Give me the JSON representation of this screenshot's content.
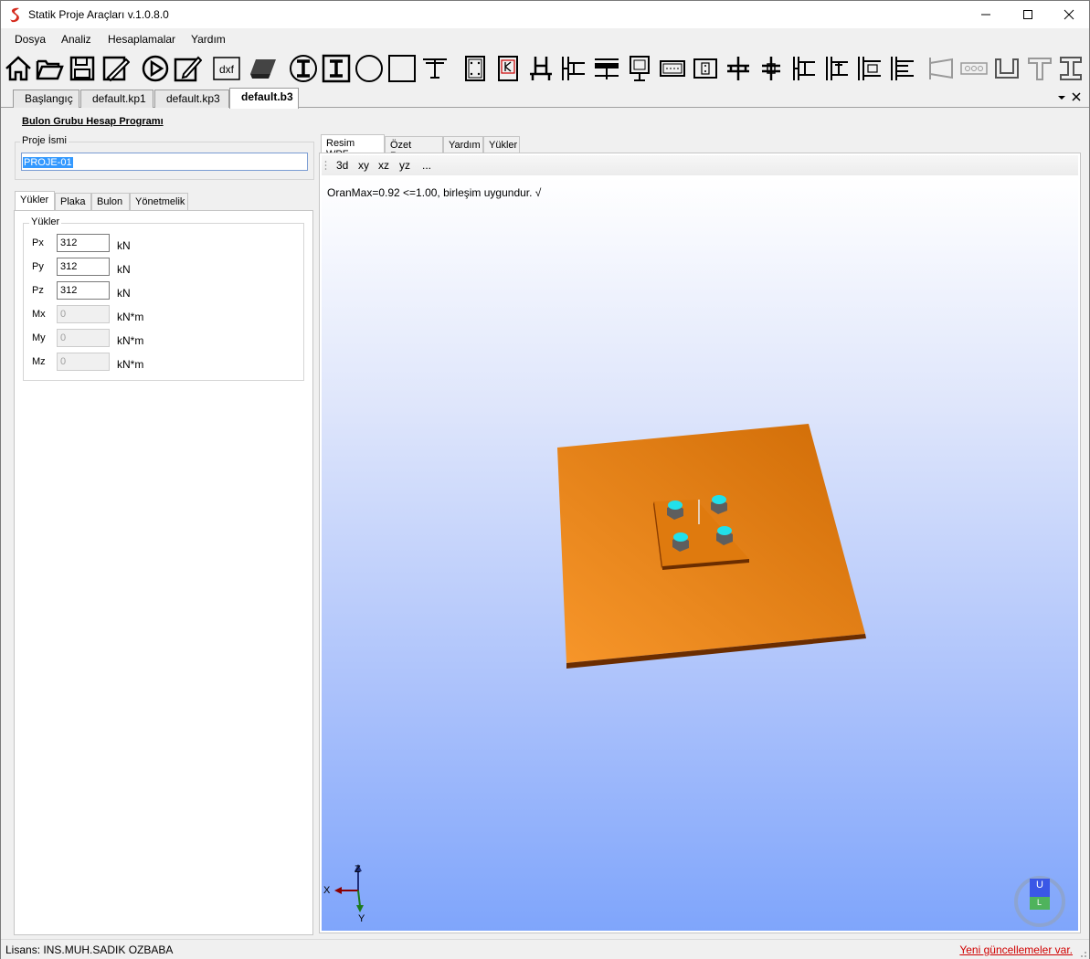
{
  "window": {
    "title": "Statik Proje Araçları v.1.0.8.0",
    "controls": {
      "minimize": "—",
      "maximize": "☐",
      "close": "✕"
    }
  },
  "menu": [
    "Dosya",
    "Analiz",
    "Hesaplamalar",
    "Yardım"
  ],
  "toolbar": {
    "icons": [
      "home-icon",
      "open-folder-icon",
      "save-icon",
      "edit-drawing-icon",
      "run-icon",
      "pencil-icon",
      "dxf-icon",
      "plate-3d-icon",
      "i-beam-circle-icon",
      "i-beam-square-icon",
      "circle-section-icon",
      "square-section-icon",
      "t-section-icon",
      "bolt-plate-icon",
      "k-plate-icon",
      "column-base-icon",
      "beam-column-icon",
      "beam-splice-icon",
      "end-plate-icon",
      "plate-bolts-icon",
      "flange-splice-icon",
      "column-splice-icon",
      "web-splice-icon",
      "shear-tab-icon",
      "double-angle-icon",
      "seat-angle-icon",
      "stiffener-icon",
      "gusset-icon",
      "bracing-icon",
      "angle-section-icon",
      "bolt-row-icon",
      "channel-section-icon",
      "tee-section-icon",
      "i-section-icon"
    ],
    "dxf_label": "dxf"
  },
  "doc_tabs": [
    "Başlangıç",
    "default.kp1",
    "default.kp3",
    "default.b3"
  ],
  "active_doc_tab": "default.b3",
  "left": {
    "program_title": "Bulon Grubu Hesap Programı",
    "project_group_label": "Proje İsmi",
    "project_name": "PROJE-01",
    "tabs": [
      "Yükler",
      "Plaka",
      "Bulon",
      "Yönetmelik"
    ],
    "loads_group_label": "Yükler",
    "loads": [
      {
        "label": "Px",
        "value": "312",
        "unit": "kN",
        "enabled": true
      },
      {
        "label": "Py",
        "value": "312",
        "unit": "kN",
        "enabled": true
      },
      {
        "label": "Pz",
        "value": "312",
        "unit": "kN",
        "enabled": true
      },
      {
        "label": "Mx",
        "value": "0",
        "unit": "kN*m",
        "enabled": false
      },
      {
        "label": "My",
        "value": "0",
        "unit": "kN*m",
        "enabled": false
      },
      {
        "label": "Mz",
        "value": "0",
        "unit": "kN*m",
        "enabled": false
      }
    ]
  },
  "right": {
    "tabs": [
      "Resim WPF",
      "Özet Rapor",
      "Yardım",
      "Yükler"
    ],
    "view_buttons": [
      "3d",
      "xy",
      "xz",
      "yz",
      "..."
    ],
    "ratio_text": "OranMax=0.92 <=1.00, birleşim uygundur. √",
    "axes": {
      "z": "Z",
      "x": "X",
      "y": "Y"
    },
    "view_cube": {
      "top": "U",
      "front": "L"
    }
  },
  "status": {
    "license": "Lisans: INS.MUH.SADIK OZBABA",
    "update": "Yeni güncellemeler var."
  },
  "colors": {
    "plate": "#e07c12",
    "bolt": "#22e0ea",
    "nut": "#666666",
    "link": "#d00000",
    "selection": "#3399ff"
  }
}
